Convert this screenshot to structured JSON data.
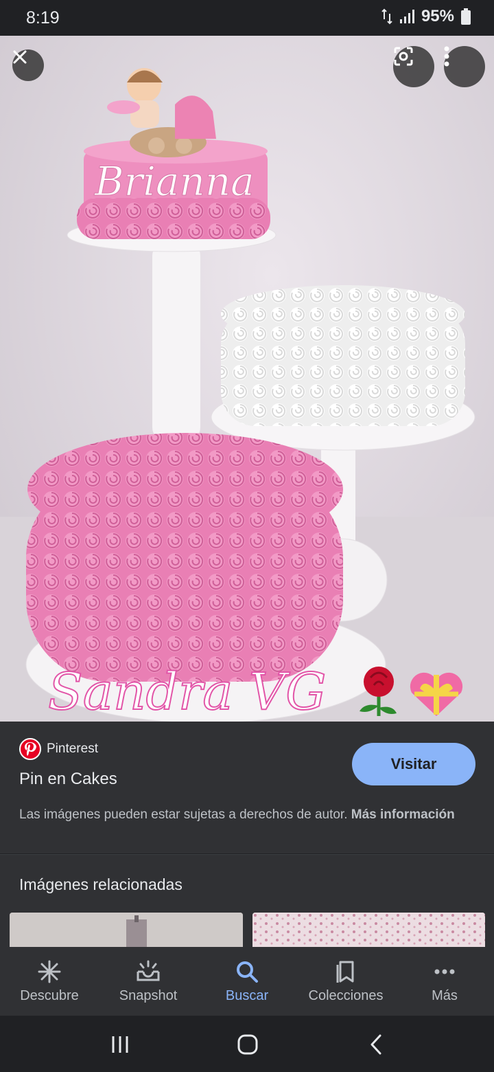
{
  "status_bar": {
    "time": "8:19",
    "battery": "95%"
  },
  "hero": {
    "cake_text": "Brianna",
    "watermark": "Sandra VG"
  },
  "pin": {
    "source": "Pinterest",
    "title": "Pin en Cakes",
    "visit_label": "Visitar",
    "copyright_text": "Las imágenes pueden estar sujetas a derechos de autor.",
    "more_info_label": "Más información"
  },
  "related": {
    "title": "Imágenes relacionadas"
  },
  "bottom_nav": {
    "items": [
      {
        "label": "Descubre",
        "icon": "asterisk-icon"
      },
      {
        "label": "Snapshot",
        "icon": "snapshot-icon"
      },
      {
        "label": "Buscar",
        "icon": "search-icon"
      },
      {
        "label": "Colecciones",
        "icon": "collections-icon"
      },
      {
        "label": "Más",
        "icon": "more-horizontal-icon"
      }
    ],
    "active_index": 2
  },
  "colors": {
    "accent": "#8ab4f8",
    "pinterest": "#e60023",
    "panel": "#303134",
    "background": "#202124"
  }
}
